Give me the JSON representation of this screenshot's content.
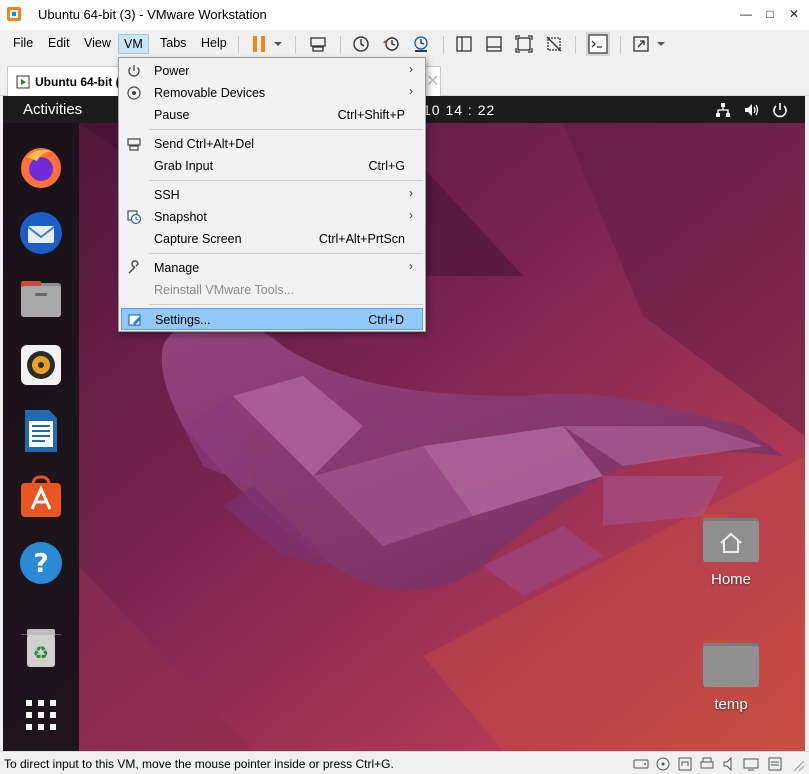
{
  "window": {
    "title": "Ubuntu 64-bit (3) - VMware Workstation",
    "controls": {
      "minimize": "—",
      "maximize": "□",
      "close": "✕"
    }
  },
  "menubar": {
    "items": [
      {
        "label": "File"
      },
      {
        "label": "Edit"
      },
      {
        "label": "View"
      },
      {
        "label": "VM"
      },
      {
        "label": "Tabs"
      },
      {
        "label": "Help"
      }
    ],
    "active": "VM"
  },
  "tab": {
    "label": "Ubuntu 64-bit (",
    "close": "✕"
  },
  "vm_menu": {
    "items": [
      {
        "label": "Power",
        "shortcut": "",
        "submenu": true,
        "icon": "power-icon"
      },
      {
        "label": "Removable Devices",
        "shortcut": "",
        "submenu": true,
        "icon": "disc-icon"
      },
      {
        "label": "Pause",
        "shortcut": "Ctrl+Shift+P",
        "submenu": false
      },
      {
        "label": "Send Ctrl+Alt+Del",
        "shortcut": "",
        "submenu": false,
        "icon": "keyboard-icon"
      },
      {
        "label": "Grab Input",
        "shortcut": "Ctrl+G",
        "submenu": false
      },
      {
        "label": "SSH",
        "shortcut": "",
        "submenu": true
      },
      {
        "label": "Snapshot",
        "shortcut": "",
        "submenu": true,
        "icon": "snapshot-icon"
      },
      {
        "label": "Capture Screen",
        "shortcut": "Ctrl+Alt+PrtScn",
        "submenu": false
      },
      {
        "label": "Manage",
        "shortcut": "",
        "submenu": true,
        "icon": "wrench-icon"
      },
      {
        "label": "Reinstall VMware Tools...",
        "shortcut": "",
        "submenu": false,
        "disabled": true
      },
      {
        "label": "Settings...",
        "shortcut": "Ctrl+D",
        "submenu": false,
        "icon": "settings-icon",
        "selected": true
      }
    ],
    "arrow": "›"
  },
  "ubuntu": {
    "activities": "Activities",
    "clock": "10 14 : 22",
    "desktop_icons": [
      {
        "label": "Home"
      },
      {
        "label": "temp"
      }
    ]
  },
  "statusbar": {
    "text": "To direct input to this VM, move the mouse pointer inside or press Ctrl+G."
  },
  "colors": {
    "accent_selection": "#91c9f7",
    "ubuntu_orange": "#e95420",
    "pause_orange": "#f5821f"
  }
}
